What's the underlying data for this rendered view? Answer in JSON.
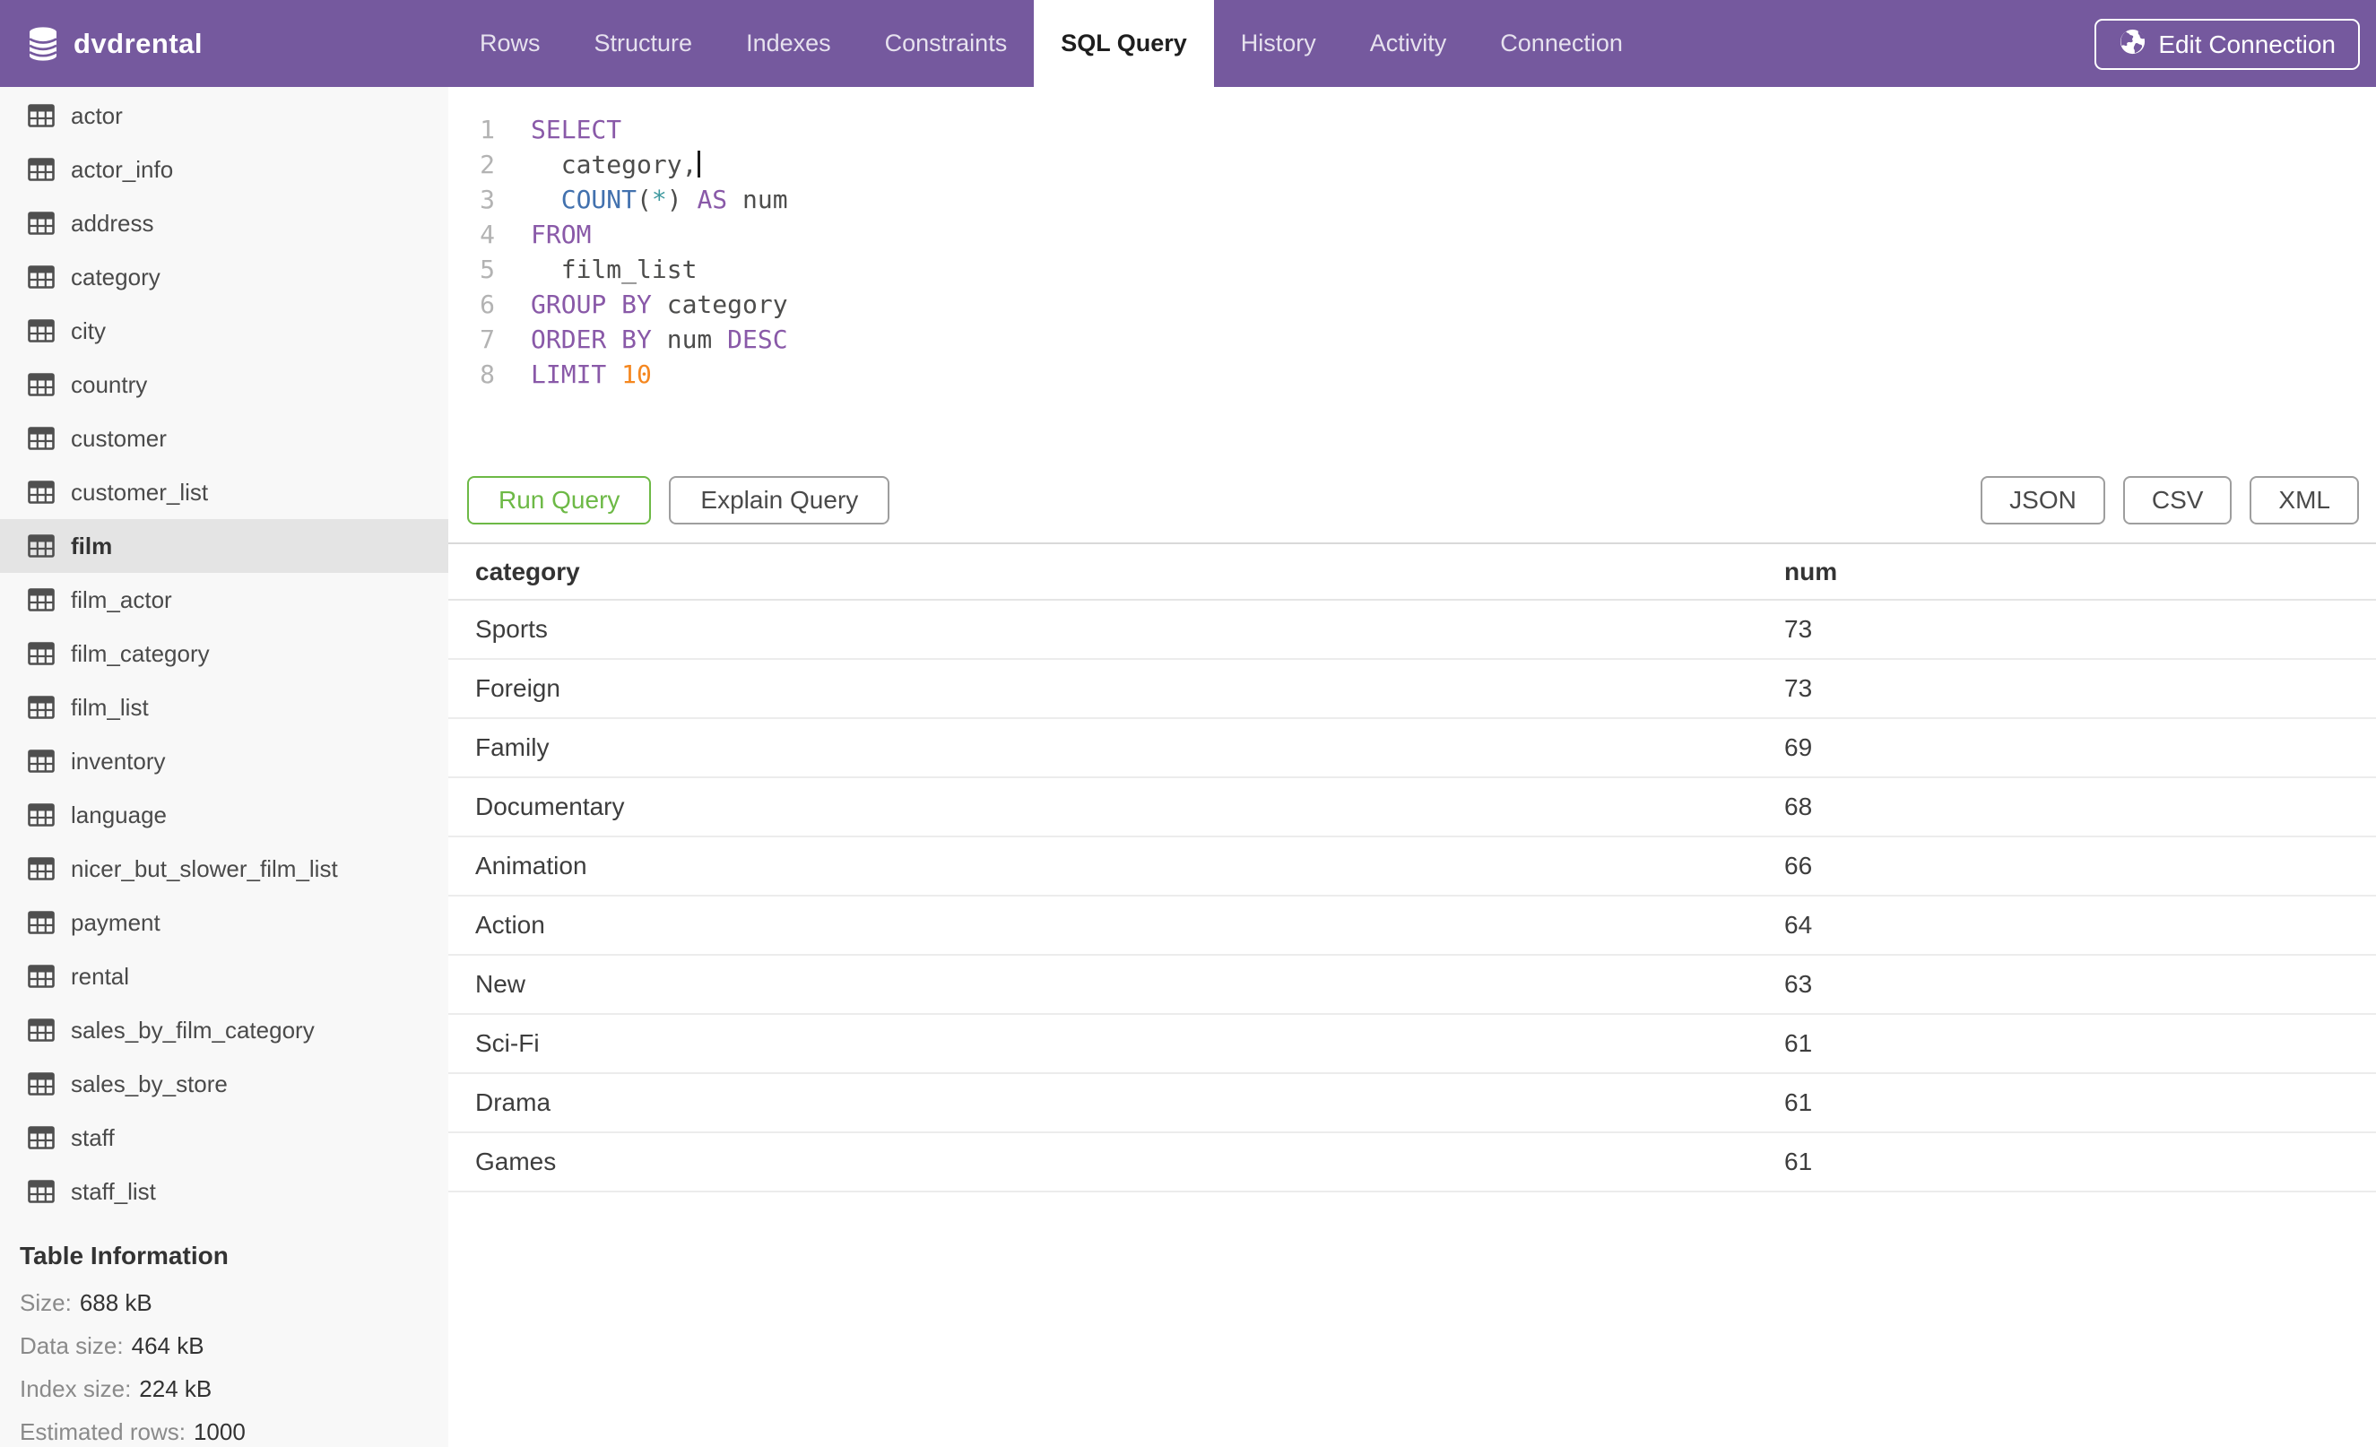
{
  "header": {
    "database": "dvdrental",
    "tabs": [
      {
        "label": "Rows",
        "active": false
      },
      {
        "label": "Structure",
        "active": false
      },
      {
        "label": "Indexes",
        "active": false
      },
      {
        "label": "Constraints",
        "active": false
      },
      {
        "label": "SQL Query",
        "active": true
      },
      {
        "label": "History",
        "active": false
      },
      {
        "label": "Activity",
        "active": false
      },
      {
        "label": "Connection",
        "active": false
      }
    ],
    "edit_connection_label": "Edit Connection"
  },
  "sidebar": {
    "tables": [
      "actor",
      "actor_info",
      "address",
      "category",
      "city",
      "country",
      "customer",
      "customer_list",
      "film",
      "film_actor",
      "film_category",
      "film_list",
      "inventory",
      "language",
      "nicer_but_slower_film_list",
      "payment",
      "rental",
      "sales_by_film_category",
      "sales_by_store",
      "staff",
      "staff_list"
    ],
    "selected_table": "film",
    "table_information": {
      "title": "Table Information",
      "rows": [
        {
          "label": "Size:",
          "value": "688 kB"
        },
        {
          "label": "Data size:",
          "value": "464 kB"
        },
        {
          "label": "Index size:",
          "value": "224 kB"
        },
        {
          "label": "Estimated rows:",
          "value": "1000"
        }
      ]
    }
  },
  "editor": {
    "cursor_after_line": 2,
    "lines": [
      [
        {
          "t": "SELECT",
          "c": "kw"
        }
      ],
      [
        {
          "t": "  category,",
          "c": ""
        }
      ],
      [
        {
          "t": "  ",
          "c": ""
        },
        {
          "t": "COUNT",
          "c": "fn"
        },
        {
          "t": "(",
          "c": ""
        },
        {
          "t": "*",
          "c": "op"
        },
        {
          "t": ")",
          "c": ""
        },
        {
          "t": " ",
          "c": ""
        },
        {
          "t": "AS",
          "c": "kw"
        },
        {
          "t": " num",
          "c": ""
        }
      ],
      [
        {
          "t": "FROM",
          "c": "kw"
        }
      ],
      [
        {
          "t": "  film_list",
          "c": ""
        }
      ],
      [
        {
          "t": "GROUP BY",
          "c": "kw"
        },
        {
          "t": " category",
          "c": ""
        }
      ],
      [
        {
          "t": "ORDER BY",
          "c": "kw"
        },
        {
          "t": " num ",
          "c": ""
        },
        {
          "t": "DESC",
          "c": "kw"
        }
      ],
      [
        {
          "t": "LIMIT",
          "c": "kw"
        },
        {
          "t": " ",
          "c": ""
        },
        {
          "t": "10",
          "c": "num"
        }
      ]
    ]
  },
  "actions": {
    "run_label": "Run Query",
    "explain_label": "Explain Query",
    "export_formats": [
      "JSON",
      "CSV",
      "XML"
    ]
  },
  "results": {
    "columns": [
      "category",
      "num"
    ],
    "rows": [
      {
        "category": "Sports",
        "num": "73"
      },
      {
        "category": "Foreign",
        "num": "73"
      },
      {
        "category": "Family",
        "num": "69"
      },
      {
        "category": "Documentary",
        "num": "68"
      },
      {
        "category": "Animation",
        "num": "66"
      },
      {
        "category": "Action",
        "num": "64"
      },
      {
        "category": "New",
        "num": "63"
      },
      {
        "category": "Sci-Fi",
        "num": "61"
      },
      {
        "category": "Drama",
        "num": "61"
      },
      {
        "category": "Games",
        "num": "61"
      }
    ]
  },
  "colors": {
    "navbar_purple": "#75599E",
    "run_green": "#6DB946",
    "syntax_keyword": "#8959A8",
    "syntax_function": "#4271AE",
    "syntax_operator": "#3E999F",
    "syntax_number": "#F5871F"
  }
}
